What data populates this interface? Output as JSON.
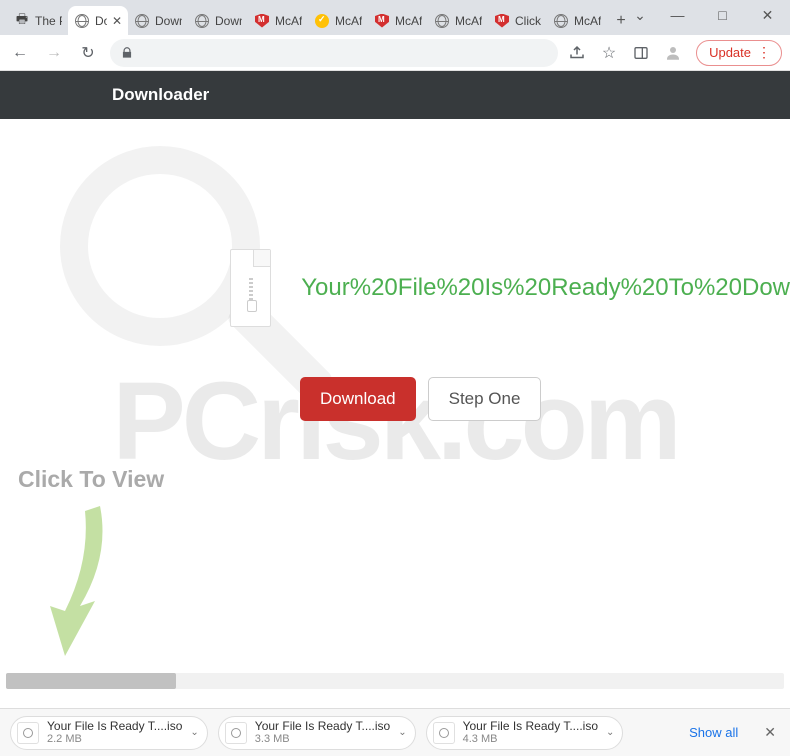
{
  "window": {
    "chevron": "⌄",
    "minimize": "—",
    "maximize": "□",
    "close": "✕"
  },
  "tabs": [
    {
      "icon": "printer",
      "title": "The P"
    },
    {
      "icon": "globe",
      "title": "Do",
      "active": true
    },
    {
      "icon": "globe",
      "title": "Down"
    },
    {
      "icon": "globe",
      "title": "Down"
    },
    {
      "icon": "shield-red",
      "title": "McAf"
    },
    {
      "icon": "shield-yellow",
      "title": "McAf"
    },
    {
      "icon": "shield-red",
      "title": "McAf"
    },
    {
      "icon": "globe",
      "title": "McAf"
    },
    {
      "icon": "shield-red",
      "title": "Click"
    },
    {
      "icon": "globe",
      "title": "McAf"
    }
  ],
  "new_tab": "+",
  "nav": {
    "back": "←",
    "forward": "→",
    "reload": "↻"
  },
  "toolbar_right": {
    "share": "⇧",
    "star": "☆",
    "panel": "▣",
    "profile": "◯",
    "update_label": "Update",
    "update_dots": "⋮"
  },
  "page": {
    "brand": "Downloader",
    "watermark": "PCrisk.com",
    "ready_text": "Your%20File%20Is%20Ready%20To%20Dow",
    "download_label": "Download",
    "step_label": "Step One",
    "click_to_view": "Click To View"
  },
  "downloads": [
    {
      "name": "Your File Is Ready T....iso",
      "size": "2.2 MB"
    },
    {
      "name": "Your File Is Ready T....iso",
      "size": "3.3 MB"
    },
    {
      "name": "Your File Is Ready T....iso",
      "size": "4.3 MB"
    }
  ],
  "download_bar": {
    "show_all": "Show all",
    "close": "✕",
    "chevron": "⌄"
  }
}
